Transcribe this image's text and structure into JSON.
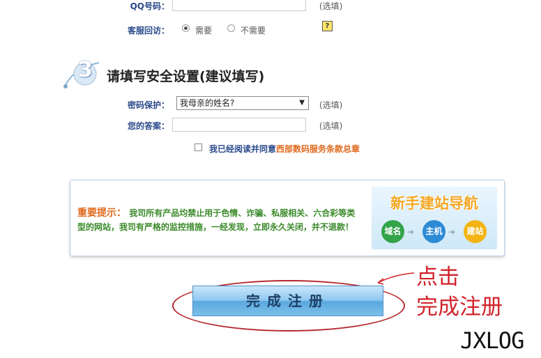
{
  "form": {
    "qq_label": "QQ号码：",
    "qq_optional": "(选填)",
    "visit_label": "客服回访：",
    "visit_yes": "需要",
    "visit_no": "不需要",
    "help_glyph": "?"
  },
  "section3": {
    "step_number": "3",
    "title": "请填写安全设置(建议填写)",
    "pwd_protect_label": "密码保护：",
    "pwd_protect_value": "我母亲的姓名?",
    "pwd_protect_optional": "(选填)",
    "answer_label": "您的答案：",
    "answer_optional": "(选填)",
    "agree_text": "我已经阅读并同意",
    "agree_link": "西部数码服务条款总章"
  },
  "notice": {
    "title": "重要提示：",
    "text_line1": "我司所有产品均禁止用于色情、诈骗、私服相关、六合彩等类",
    "text_line2": "型的网站，我司有严格的监控措施，一经发现，立即永久关闭，并不退款！",
    "guide_title": "新手建站导航",
    "guide_steps": [
      "域名",
      "主机",
      "建站"
    ]
  },
  "submit": {
    "label": "完成注册"
  },
  "annotation": {
    "line1": "点击",
    "line2": "完成注册"
  },
  "watermark": {
    "text": "JXLOG"
  },
  "colors": {
    "label": "#2b4a8b",
    "link": "#e06a1e",
    "annotation": "#d2232a",
    "notice_text": "#3a8a2a"
  }
}
